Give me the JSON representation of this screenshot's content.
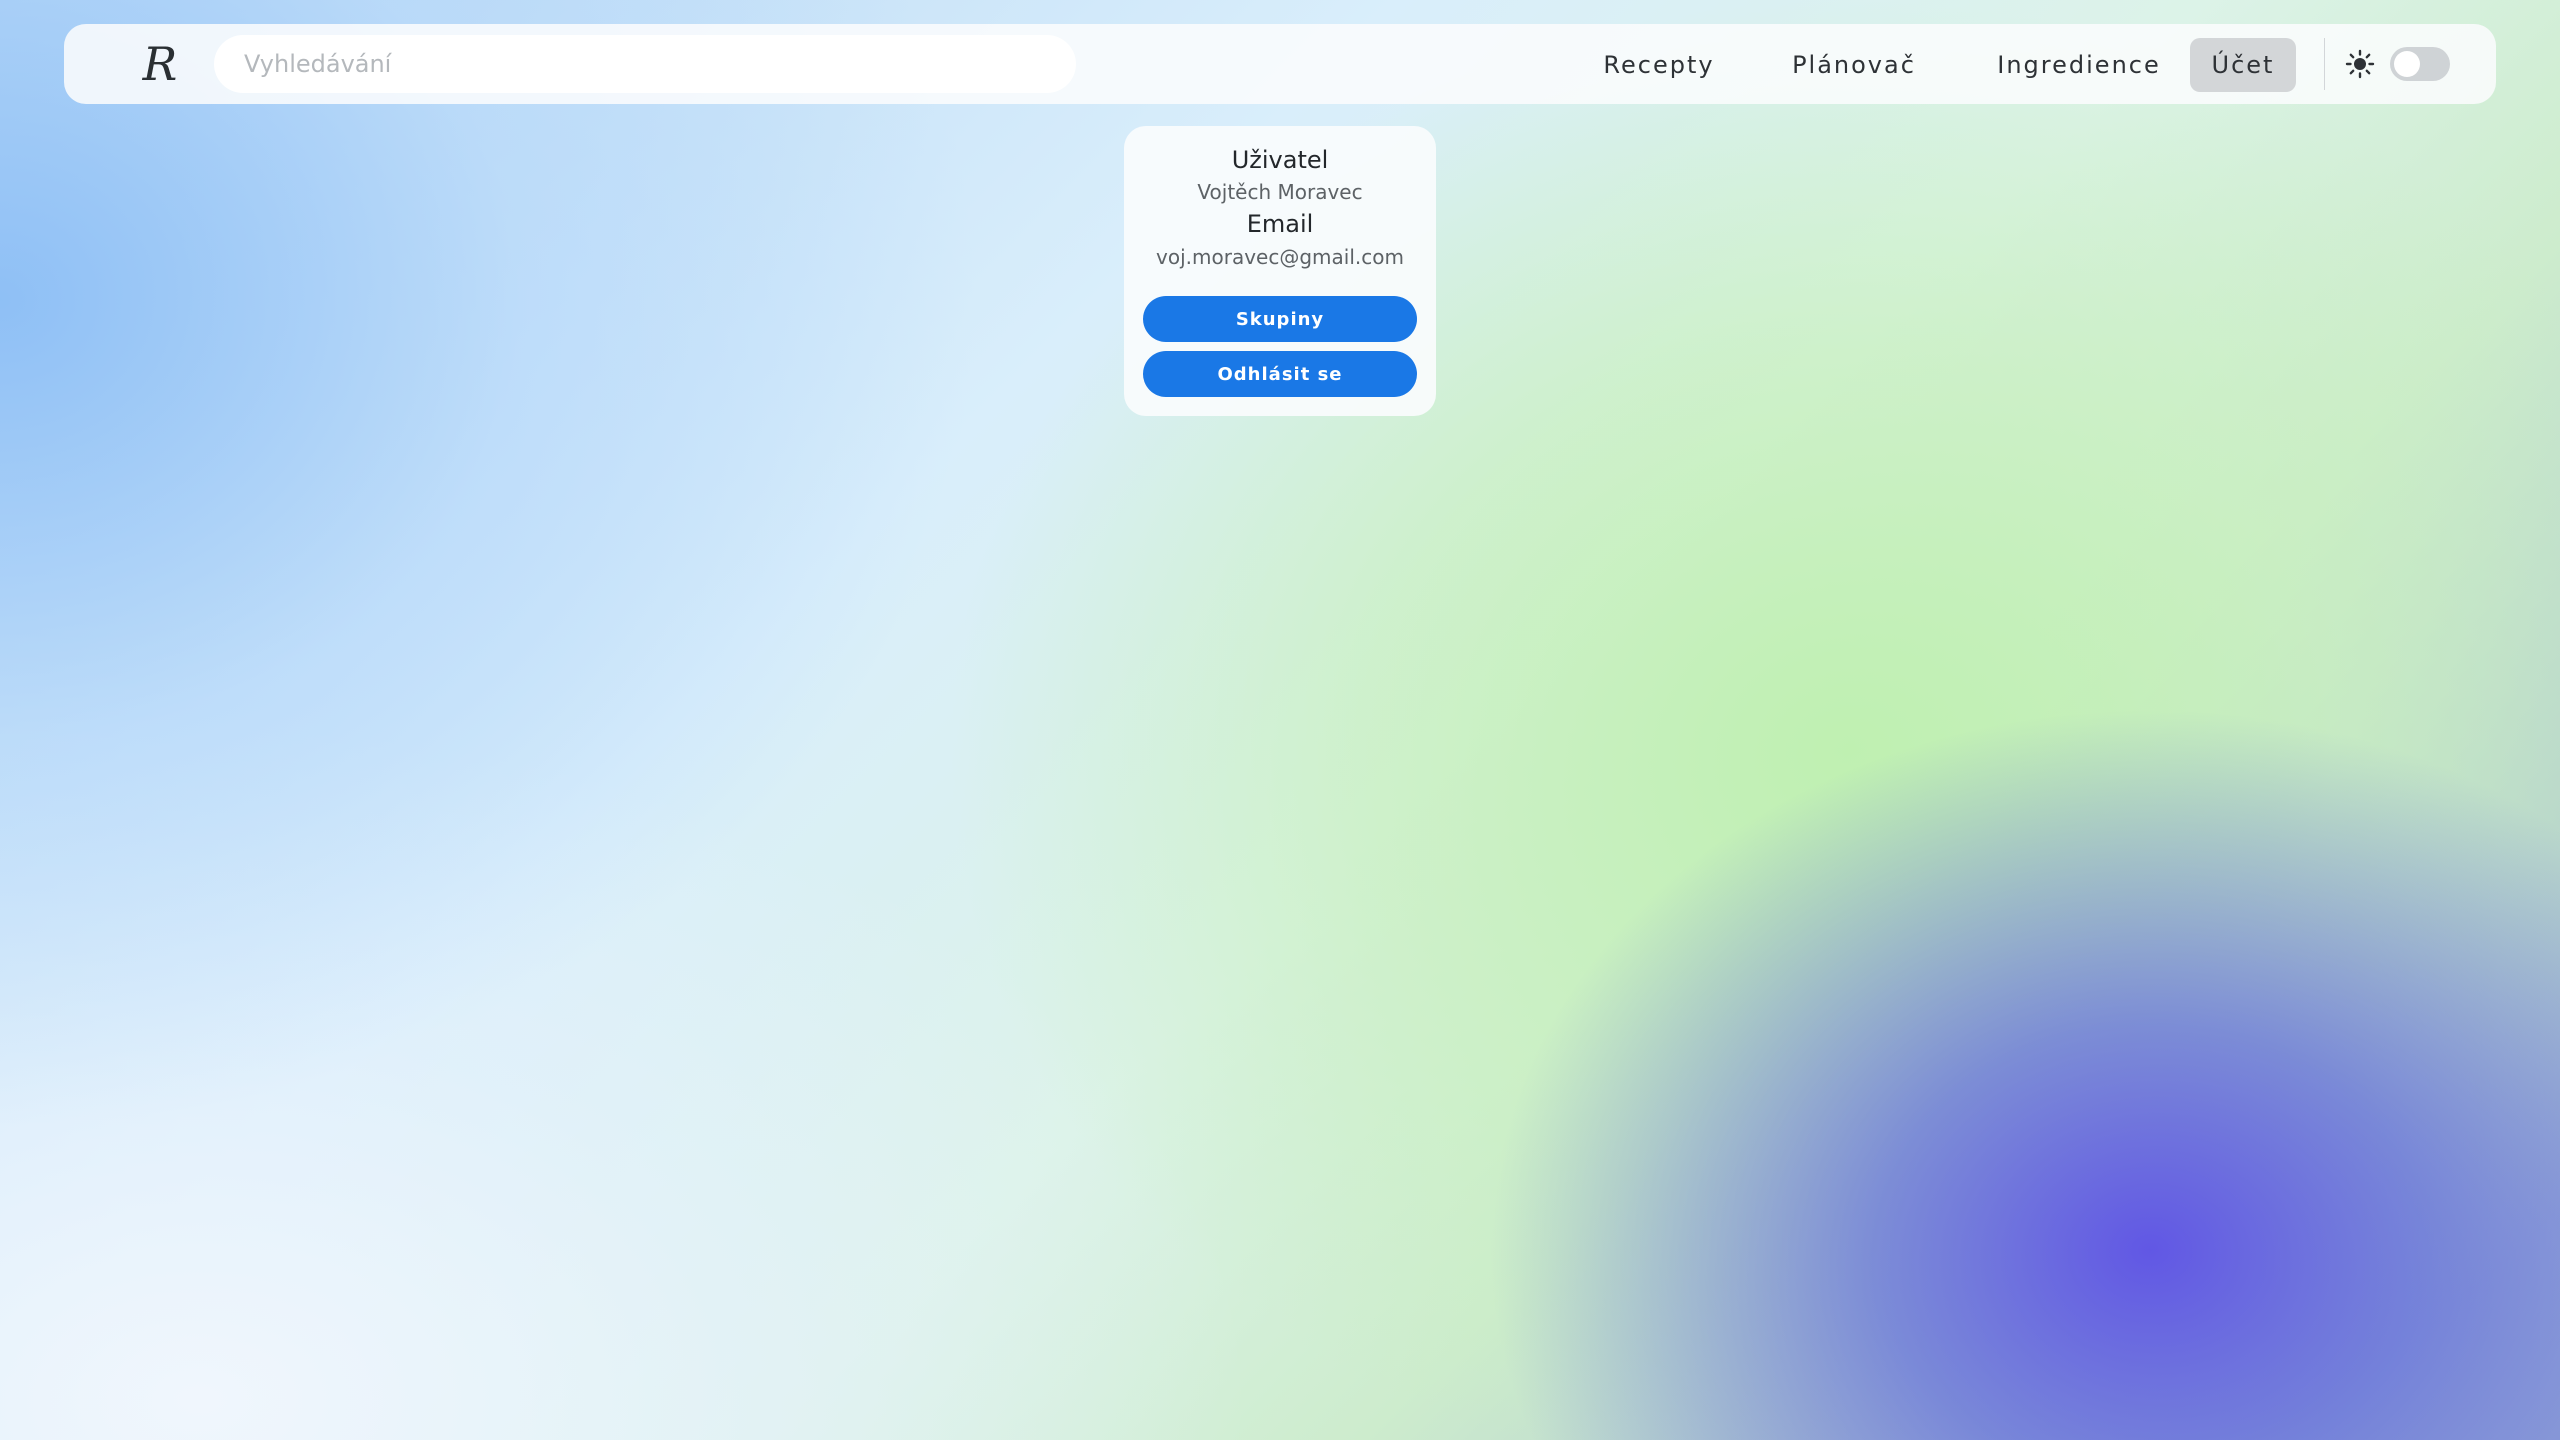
{
  "logo": {
    "text": "R"
  },
  "search": {
    "placeholder": "Vyhledávání",
    "value": ""
  },
  "nav": {
    "items": [
      {
        "label": "Recepty"
      },
      {
        "label": "Plánovač"
      },
      {
        "label": "Ingredience"
      },
      {
        "label": "Účet",
        "active": true
      }
    ]
  },
  "theme": {
    "icon": "sun-icon",
    "dark_mode": false
  },
  "account": {
    "user_label": "Uživatel",
    "user_value": "Vojtěch Moravec",
    "email_label": "Email",
    "email_value": "voj.moravec@gmail.com",
    "groups_button": "Skupiny",
    "logout_button": "Odhlásit se"
  },
  "colors": {
    "primary_button": "#1a78e6",
    "active_nav_bg": "#d3d6d8"
  }
}
